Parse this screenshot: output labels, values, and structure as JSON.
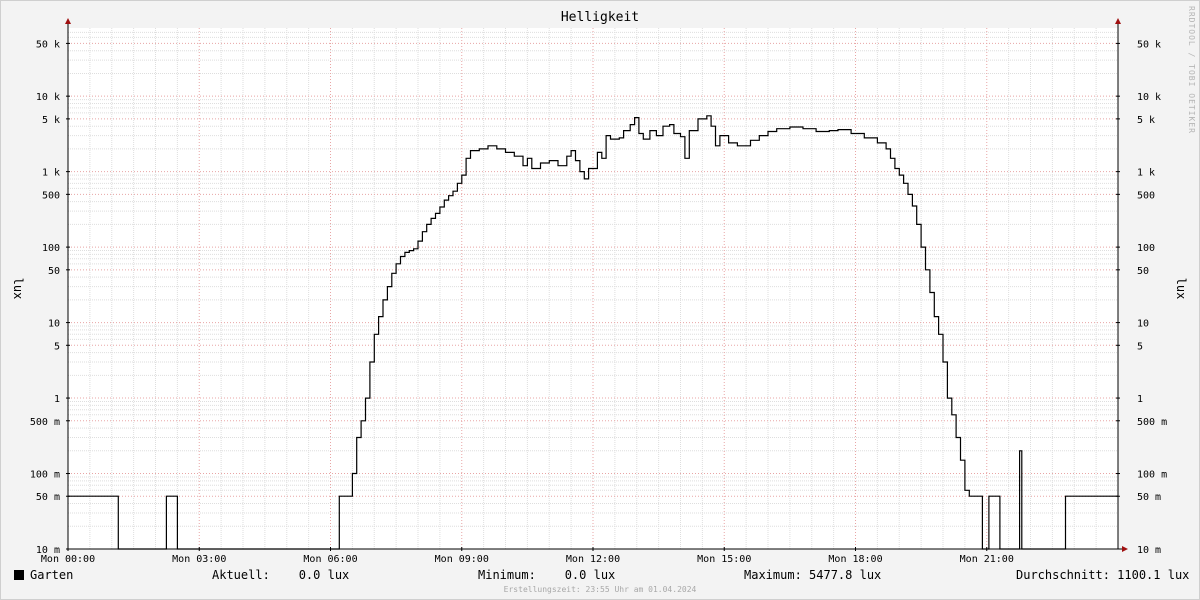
{
  "chart_data": {
    "type": "line",
    "title": "Helligkeit",
    "ylabel": "lux",
    "yscale": "log",
    "ylim": [
      0.01,
      80000
    ],
    "xlim": [
      0,
      24
    ],
    "x_unit": "hours",
    "grid": true,
    "x_ticks": [
      {
        "x": 0,
        "label": "Mon 00:00"
      },
      {
        "x": 3,
        "label": "Mon 03:00"
      },
      {
        "x": 6,
        "label": "Mon 06:00"
      },
      {
        "x": 9,
        "label": "Mon 09:00"
      },
      {
        "x": 12,
        "label": "Mon 12:00"
      },
      {
        "x": 15,
        "label": "Mon 15:00"
      },
      {
        "x": 18,
        "label": "Mon 18:00"
      },
      {
        "x": 21,
        "label": "Mon 21:00"
      }
    ],
    "y_ticks": [
      {
        "v": 0.01,
        "label": "10 m"
      },
      {
        "v": 0.05,
        "label": "50 m"
      },
      {
        "v": 0.1,
        "label": "100 m"
      },
      {
        "v": 0.5,
        "label": "500 m"
      },
      {
        "v": 1,
        "label": "1"
      },
      {
        "v": 5,
        "label": "5"
      },
      {
        "v": 10,
        "label": "10"
      },
      {
        "v": 50,
        "label": "50"
      },
      {
        "v": 100,
        "label": "100"
      },
      {
        "v": 500,
        "label": "500"
      },
      {
        "v": 1000,
        "label": "1 k"
      },
      {
        "v": 5000,
        "label": "5 k"
      },
      {
        "v": 10000,
        "label": "10 k"
      },
      {
        "v": 50000,
        "label": "50 k"
      }
    ],
    "series": [
      {
        "name": "Garten",
        "color": "#000000",
        "points": [
          [
            0.0,
            0.05
          ],
          [
            1.1,
            0.05
          ],
          [
            1.15,
            0.01
          ],
          [
            2.2,
            0.01
          ],
          [
            2.25,
            0.05
          ],
          [
            2.45,
            0.05
          ],
          [
            2.5,
            0.01
          ],
          [
            6.15,
            0.01
          ],
          [
            6.2,
            0.05
          ],
          [
            6.45,
            0.05
          ],
          [
            6.5,
            0.1
          ],
          [
            6.6,
            0.3
          ],
          [
            6.7,
            0.5
          ],
          [
            6.8,
            1.0
          ],
          [
            6.9,
            3
          ],
          [
            7.0,
            7
          ],
          [
            7.1,
            12
          ],
          [
            7.2,
            20
          ],
          [
            7.3,
            30
          ],
          [
            7.4,
            45
          ],
          [
            7.5,
            60
          ],
          [
            7.6,
            75
          ],
          [
            7.7,
            85
          ],
          [
            7.8,
            90
          ],
          [
            7.9,
            95
          ],
          [
            8.0,
            120
          ],
          [
            8.1,
            160
          ],
          [
            8.2,
            200
          ],
          [
            8.3,
            240
          ],
          [
            8.4,
            280
          ],
          [
            8.5,
            340
          ],
          [
            8.6,
            420
          ],
          [
            8.7,
            480
          ],
          [
            8.8,
            550
          ],
          [
            8.9,
            700
          ],
          [
            9.0,
            900
          ],
          [
            9.1,
            1500
          ],
          [
            9.2,
            1900
          ],
          [
            9.4,
            2000
          ],
          [
            9.6,
            2200
          ],
          [
            9.8,
            2000
          ],
          [
            10.0,
            1800
          ],
          [
            10.2,
            1600
          ],
          [
            10.4,
            1200
          ],
          [
            10.5,
            1500
          ],
          [
            10.6,
            1100
          ],
          [
            10.8,
            1300
          ],
          [
            11.0,
            1400
          ],
          [
            11.2,
            1200
          ],
          [
            11.4,
            1600
          ],
          [
            11.5,
            1900
          ],
          [
            11.6,
            1400
          ],
          [
            11.7,
            1000
          ],
          [
            11.8,
            800
          ],
          [
            11.9,
            1100
          ],
          [
            12.1,
            1800
          ],
          [
            12.2,
            1500
          ],
          [
            12.3,
            3000
          ],
          [
            12.4,
            2700
          ],
          [
            12.6,
            2800
          ],
          [
            12.7,
            3500
          ],
          [
            12.85,
            4200
          ],
          [
            12.95,
            5200
          ],
          [
            13.05,
            3200
          ],
          [
            13.15,
            2700
          ],
          [
            13.3,
            3500
          ],
          [
            13.45,
            3000
          ],
          [
            13.6,
            4000
          ],
          [
            13.75,
            4200
          ],
          [
            13.85,
            3200
          ],
          [
            14.0,
            2900
          ],
          [
            14.1,
            1500
          ],
          [
            14.2,
            3500
          ],
          [
            14.4,
            5000
          ],
          [
            14.6,
            5500
          ],
          [
            14.7,
            4000
          ],
          [
            14.8,
            2200
          ],
          [
            14.9,
            3000
          ],
          [
            15.1,
            2400
          ],
          [
            15.3,
            2200
          ],
          [
            15.6,
            2600
          ],
          [
            15.8,
            3000
          ],
          [
            16.0,
            3400
          ],
          [
            16.2,
            3700
          ],
          [
            16.5,
            3900
          ],
          [
            16.8,
            3700
          ],
          [
            17.1,
            3400
          ],
          [
            17.4,
            3500
          ],
          [
            17.6,
            3600
          ],
          [
            17.9,
            3200
          ],
          [
            18.2,
            2800
          ],
          [
            18.5,
            2400
          ],
          [
            18.7,
            2000
          ],
          [
            18.8,
            1500
          ],
          [
            18.9,
            1100
          ],
          [
            19.0,
            900
          ],
          [
            19.1,
            700
          ],
          [
            19.2,
            500
          ],
          [
            19.3,
            350
          ],
          [
            19.4,
            200
          ],
          [
            19.5,
            100
          ],
          [
            19.6,
            50
          ],
          [
            19.7,
            25
          ],
          [
            19.8,
            12
          ],
          [
            19.9,
            7
          ],
          [
            20.0,
            3
          ],
          [
            20.1,
            1
          ],
          [
            20.2,
            0.6
          ],
          [
            20.3,
            0.3
          ],
          [
            20.4,
            0.15
          ],
          [
            20.5,
            0.06
          ],
          [
            20.6,
            0.05
          ],
          [
            20.85,
            0.05
          ],
          [
            20.9,
            0.01
          ],
          [
            21.0,
            0.01
          ],
          [
            21.05,
            0.05
          ],
          [
            21.25,
            0.05
          ],
          [
            21.3,
            0.01
          ],
          [
            21.7,
            0.01
          ],
          [
            21.75,
            0.2
          ],
          [
            21.8,
            0.01
          ],
          [
            22.75,
            0.01
          ],
          [
            22.8,
            0.05
          ],
          [
            24.0,
            0.05
          ]
        ]
      }
    ]
  },
  "legend": {
    "series_name": "Garten",
    "current": "Aktuell:    0.0 lux",
    "minimum": "Minimum:    0.0 lux",
    "maximum": "Maximum: 5477.8 lux",
    "average": "Durchschnitt: 1100.1 lux"
  },
  "watermark": "RRDTOOL / TOBI OETIKER",
  "footer": "Erstellungszeit: 23:55 Uhr am 01.04.2024"
}
